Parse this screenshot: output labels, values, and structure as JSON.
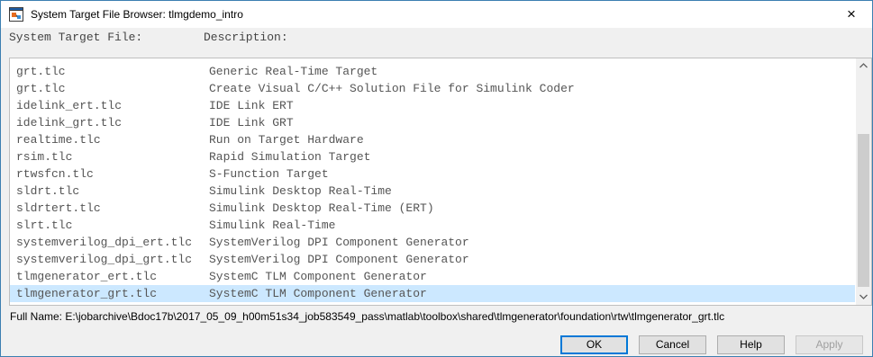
{
  "window": {
    "title": "System Target File Browser: tlmgdemo_intro",
    "close_label": "×"
  },
  "columns": {
    "file": "System Target File:",
    "description": "Description:"
  },
  "rows": [
    {
      "file": "grt.tlc",
      "description": "Generic Real-Time Target",
      "selected": false
    },
    {
      "file": "grt.tlc",
      "description": "Create Visual C/C++ Solution File for Simulink Coder",
      "selected": false
    },
    {
      "file": "idelink_ert.tlc",
      "description": "IDE Link ERT",
      "selected": false
    },
    {
      "file": "idelink_grt.tlc",
      "description": "IDE Link GRT",
      "selected": false
    },
    {
      "file": "realtime.tlc",
      "description": "Run on Target Hardware",
      "selected": false
    },
    {
      "file": "rsim.tlc",
      "description": "Rapid Simulation Target",
      "selected": false
    },
    {
      "file": "rtwsfcn.tlc",
      "description": "S-Function Target",
      "selected": false
    },
    {
      "file": "sldrt.tlc",
      "description": "Simulink Desktop Real-Time",
      "selected": false
    },
    {
      "file": "sldrtert.tlc",
      "description": "Simulink Desktop Real-Time (ERT)",
      "selected": false
    },
    {
      "file": "slrt.tlc",
      "description": "Simulink Real-Time",
      "selected": false
    },
    {
      "file": "systemverilog_dpi_ert.tlc",
      "description": "SystemVerilog DPI Component Generator",
      "selected": false
    },
    {
      "file": "systemverilog_dpi_grt.tlc",
      "description": "SystemVerilog DPI Component Generator",
      "selected": false
    },
    {
      "file": "tlmgenerator_ert.tlc",
      "description": "SystemC TLM Component Generator",
      "selected": false
    },
    {
      "file": "tlmgenerator_grt.tlc",
      "description": "SystemC TLM Component Generator",
      "selected": true
    }
  ],
  "scrollbar": {
    "up_icon": "chevron-up-icon",
    "down_icon": "chevron-down-icon"
  },
  "full_name": "Full Name: E:\\jobarchive\\Bdoc17b\\2017_05_09_h00m51s34_job583549_pass\\matlab\\toolbox\\shared\\tlmgenerator\\foundation\\rtw\\tlmgenerator_grt.tlc",
  "buttons": {
    "ok": "OK",
    "cancel": "Cancel",
    "help": "Help",
    "apply": "Apply"
  },
  "colors": {
    "selection": "#cce8ff",
    "window_border": "#3c7fb1",
    "default_button_border": "#0078d7"
  }
}
